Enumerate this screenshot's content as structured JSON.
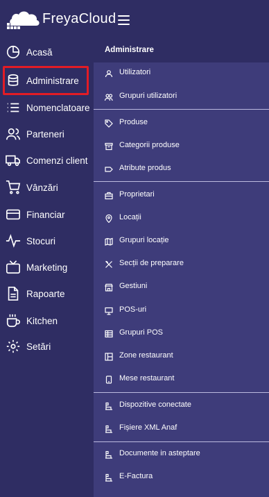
{
  "brand": {
    "name": "FreyaCloud",
    "logo_icon": "cloud-grid-logo"
  },
  "header": {
    "menu_icon": "hamburger-icon"
  },
  "sidebar": {
    "items": [
      {
        "label": "Acasă",
        "icon": "pie-chart-icon"
      },
      {
        "label": "Administrare",
        "icon": "database-icon",
        "active": true
      },
      {
        "label": "Nomenclatoare",
        "icon": "list-icon"
      },
      {
        "label": "Parteneri",
        "icon": "users-icon"
      },
      {
        "label": "Comenzi client",
        "icon": "truck-icon"
      },
      {
        "label": "Vânzări",
        "icon": "cart-icon"
      },
      {
        "label": "Financiar",
        "icon": "card-icon"
      },
      {
        "label": "Stocuri",
        "icon": "activity-icon"
      },
      {
        "label": "Marketing",
        "icon": "tv-icon"
      },
      {
        "label": "Rapoarte",
        "icon": "file-icon"
      },
      {
        "label": "Kitchen",
        "icon": "coffee-icon"
      },
      {
        "label": "Setări",
        "icon": "gear-icon"
      }
    ]
  },
  "submenu": {
    "title": "Administrare",
    "items": [
      {
        "label": "Utilizatori",
        "icon": "user-icon"
      },
      {
        "label": "Grupuri utilizatori",
        "icon": "user-group-icon"
      },
      {
        "label": "Produse",
        "icon": "tag-icon"
      },
      {
        "label": "Categorii produse",
        "icon": "archive-icon"
      },
      {
        "label": "Atribute produs",
        "icon": "label-icon"
      },
      {
        "label": "Proprietari",
        "icon": "briefcase-icon"
      },
      {
        "label": "Locații",
        "icon": "pin-icon"
      },
      {
        "label": "Grupuri locație",
        "icon": "map-icon"
      },
      {
        "label": "Secții de preparare",
        "icon": "utensils-icon"
      },
      {
        "label": "Gestiuni",
        "icon": "store-icon"
      },
      {
        "label": "POS-uri",
        "icon": "monitor-icon"
      },
      {
        "label": "Grupuri POS",
        "icon": "pos-group-icon"
      },
      {
        "label": "Zone restaurant",
        "icon": "layout-icon"
      },
      {
        "label": "Mese restaurant",
        "icon": "tablet-icon"
      },
      {
        "label": "Dispozitive conectate",
        "icon": "device-icon"
      },
      {
        "label": "Fișiere XML Anaf",
        "icon": "device-icon"
      },
      {
        "label": "Documente in asteptare",
        "icon": "device-icon"
      },
      {
        "label": "E-Factura",
        "icon": "device-icon"
      }
    ]
  },
  "colors": {
    "background": "#2f2d63",
    "panel": "#3e3c7a",
    "highlight": "#e31c25"
  }
}
